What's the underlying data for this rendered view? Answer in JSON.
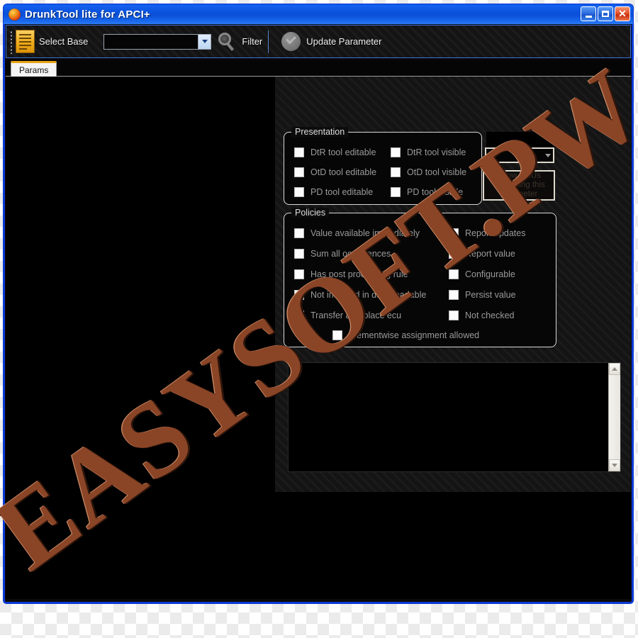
{
  "window": {
    "title": "DrunkTool lite for APCI+",
    "icon": "drunk-face-icon",
    "buttons": {
      "minimize": "_",
      "maximize": "□",
      "close": "✕"
    }
  },
  "toolbar": {
    "select_base_label": "Select Base",
    "select_base_icon": "document-icon",
    "base_combo": {
      "value": "",
      "placeholder": ""
    },
    "filter_label": "Filter",
    "filter_icon": "magnifier-icon",
    "update_label": "Update Parameter",
    "update_icon": "check-circle-icon"
  },
  "tabs": [
    {
      "label": "Params",
      "selected": true
    }
  ],
  "presentation": {
    "title": "Presentation",
    "left": [
      {
        "label": "DtR tool editable",
        "checked": false
      },
      {
        "label": "OtD tool editable",
        "checked": false
      },
      {
        "label": "PD tool editable",
        "checked": false
      }
    ],
    "right": [
      {
        "label": "DtR tool visible",
        "checked": false
      },
      {
        "label": "OtD tool visible",
        "checked": false
      },
      {
        "label": "PD tool visible",
        "checked": false
      }
    ]
  },
  "policies": {
    "title": "Policies",
    "left": [
      {
        "label": "Value available immediately",
        "checked": false
      },
      {
        "label": "Sum all occurrences",
        "checked": false
      },
      {
        "label": "Has post processing rule",
        "checked": false
      },
      {
        "label": "Not included in downloadable",
        "checked": false
      },
      {
        "label": "Transfer at replace ecu",
        "checked": false
      }
    ],
    "right": [
      {
        "label": "Report updates",
        "checked": false
      },
      {
        "label": "Report value",
        "checked": false
      },
      {
        "label": "Configurable",
        "checked": false
      },
      {
        "label": "Persist value",
        "checked": false
      },
      {
        "label": "Not checked",
        "checked": false
      }
    ],
    "bottom": {
      "label": "Elementwise assignment allowed",
      "checked": false
    }
  },
  "side": {
    "combo": {
      "value": ""
    },
    "ecu_button": "Show ECUs containing this parameter"
  },
  "listbox": {
    "items": [],
    "scroll_up": "▲",
    "scroll_down": "▼"
  },
  "watermark": {
    "text": "EASYSOFT.PW"
  },
  "colors": {
    "titlebar_blue": "#0a52dc",
    "frame_blue": "#0a3ad6",
    "tab_accent": "#e8a317",
    "toolbar_dark": "#141414",
    "watermark_brown": "#8a4426",
    "close_red": "#c92f0d"
  }
}
